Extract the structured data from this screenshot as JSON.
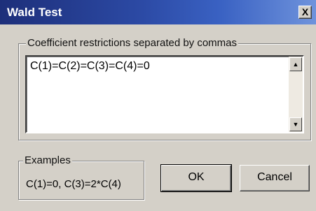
{
  "window": {
    "title": "Wald Test",
    "close_label": "X"
  },
  "restrictions": {
    "group_label": "Coefficient restrictions separated by commas",
    "value": "C(1)=C(2)=C(3)=C(4)=0",
    "scroll_up_glyph": "▲",
    "scroll_down_glyph": "▼"
  },
  "examples": {
    "group_label": "Examples",
    "text": "C(1)=0,  C(3)=2*C(4)"
  },
  "buttons": {
    "ok_label": "OK",
    "cancel_label": "Cancel"
  }
}
